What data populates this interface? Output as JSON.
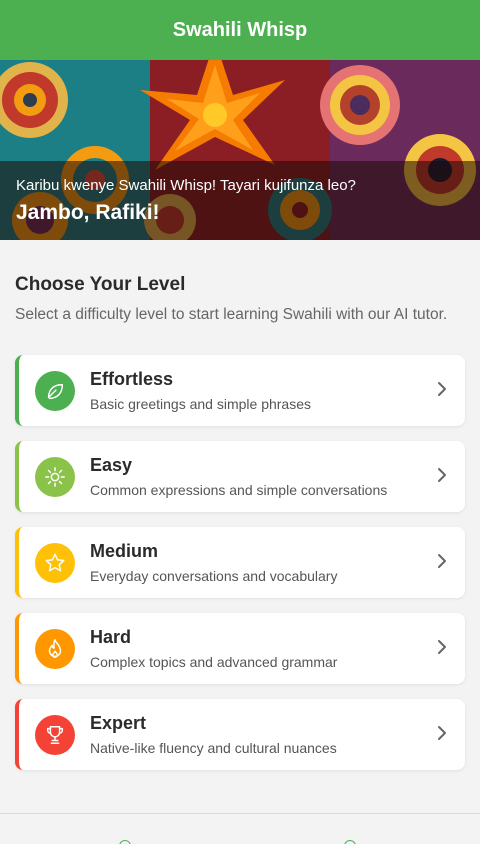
{
  "header": {
    "title": "Swahili Whisp"
  },
  "hero": {
    "subtitle": "Karibu kwenye Swahili Whisp! Tayari kujifunza leo?",
    "title": "Jambo, Rafiki!"
  },
  "section": {
    "title": "Choose Your Level",
    "description": "Select a difficulty level to start learning Swahili with our AI tutor."
  },
  "levels": [
    {
      "name": "Effortless",
      "description": "Basic greetings and simple phrases",
      "color": "#4caf50",
      "icon": "leaf-icon"
    },
    {
      "name": "Easy",
      "description": "Common expressions and simple conversations",
      "color": "#8bc34a",
      "icon": "sun-icon"
    },
    {
      "name": "Medium",
      "description": "Everyday conversations and vocabulary",
      "color": "#ffc107",
      "icon": "star-icon"
    },
    {
      "name": "Hard",
      "description": "Complex topics and advanced grammar",
      "color": "#ff9800",
      "icon": "flame-icon"
    },
    {
      "name": "Expert",
      "description": "Native-like fluency and cultural nuances",
      "color": "#f44336",
      "icon": "trophy-icon"
    }
  ],
  "bottom_nav": {
    "items": [
      "home-icon",
      "profile-icon"
    ]
  }
}
